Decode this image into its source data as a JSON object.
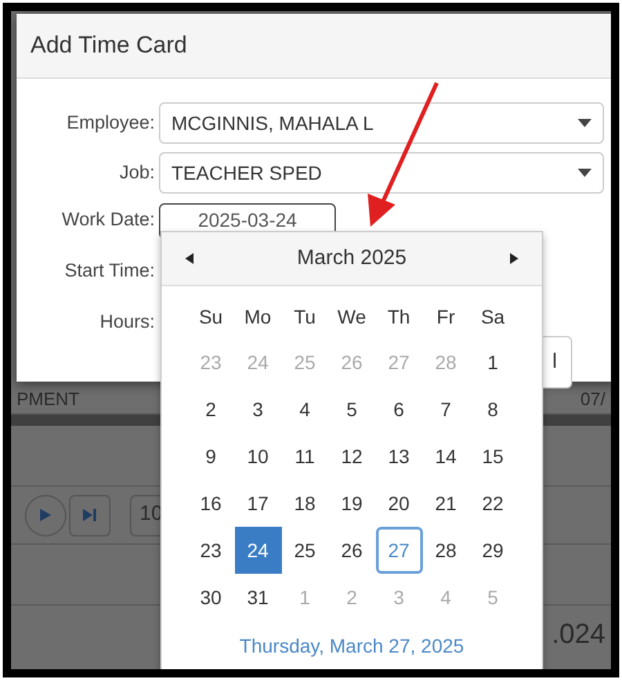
{
  "dialog": {
    "title": "Add Time Card",
    "fields": [
      {
        "label": "Employee:",
        "kind": "select",
        "value": "MCGINNIS, MAHALA L"
      },
      {
        "label": "Job:",
        "kind": "select",
        "value": "TEACHER SPED"
      },
      {
        "label": "Work Date:",
        "kind": "date",
        "value": "2025-03-24"
      },
      {
        "label": "Start Time:",
        "kind": "hidden"
      },
      {
        "label": "Hours:",
        "kind": "hidden"
      }
    ],
    "button_fragment": "l"
  },
  "calendar": {
    "title": "March 2025",
    "weekdays": [
      "Su",
      "Mo",
      "Tu",
      "We",
      "Th",
      "Fr",
      "Sa"
    ],
    "weeks": [
      [
        {
          "label": "23",
          "outside": true,
          "selected": false,
          "today": false
        },
        {
          "label": "24",
          "outside": true,
          "selected": false,
          "today": false
        },
        {
          "label": "25",
          "outside": true,
          "selected": false,
          "today": false
        },
        {
          "label": "26",
          "outside": true,
          "selected": false,
          "today": false
        },
        {
          "label": "27",
          "outside": true,
          "selected": false,
          "today": false
        },
        {
          "label": "28",
          "outside": true,
          "selected": false,
          "today": false
        },
        {
          "label": "1",
          "outside": false,
          "selected": false,
          "today": false
        }
      ],
      [
        {
          "label": "2",
          "outside": false,
          "selected": false,
          "today": false
        },
        {
          "label": "3",
          "outside": false,
          "selected": false,
          "today": false
        },
        {
          "label": "4",
          "outside": false,
          "selected": false,
          "today": false
        },
        {
          "label": "5",
          "outside": false,
          "selected": false,
          "today": false
        },
        {
          "label": "6",
          "outside": false,
          "selected": false,
          "today": false
        },
        {
          "label": "7",
          "outside": false,
          "selected": false,
          "today": false
        },
        {
          "label": "8",
          "outside": false,
          "selected": false,
          "today": false
        }
      ],
      [
        {
          "label": "9",
          "outside": false,
          "selected": false,
          "today": false
        },
        {
          "label": "10",
          "outside": false,
          "selected": false,
          "today": false
        },
        {
          "label": "11",
          "outside": false,
          "selected": false,
          "today": false
        },
        {
          "label": "12",
          "outside": false,
          "selected": false,
          "today": false
        },
        {
          "label": "13",
          "outside": false,
          "selected": false,
          "today": false
        },
        {
          "label": "14",
          "outside": false,
          "selected": false,
          "today": false
        },
        {
          "label": "15",
          "outside": false,
          "selected": false,
          "today": false
        }
      ],
      [
        {
          "label": "16",
          "outside": false,
          "selected": false,
          "today": false
        },
        {
          "label": "17",
          "outside": false,
          "selected": false,
          "today": false
        },
        {
          "label": "18",
          "outside": false,
          "selected": false,
          "today": false
        },
        {
          "label": "19",
          "outside": false,
          "selected": false,
          "today": false
        },
        {
          "label": "20",
          "outside": false,
          "selected": false,
          "today": false
        },
        {
          "label": "21",
          "outside": false,
          "selected": false,
          "today": false
        },
        {
          "label": "22",
          "outside": false,
          "selected": false,
          "today": false
        }
      ],
      [
        {
          "label": "23",
          "outside": false,
          "selected": false,
          "today": false
        },
        {
          "label": "24",
          "outside": false,
          "selected": true,
          "today": false
        },
        {
          "label": "25",
          "outside": false,
          "selected": false,
          "today": false
        },
        {
          "label": "26",
          "outside": false,
          "selected": false,
          "today": false
        },
        {
          "label": "27",
          "outside": false,
          "selected": false,
          "today": true
        },
        {
          "label": "28",
          "outside": false,
          "selected": false,
          "today": false
        },
        {
          "label": "29",
          "outside": false,
          "selected": false,
          "today": false
        }
      ],
      [
        {
          "label": "30",
          "outside": false,
          "selected": false,
          "today": false
        },
        {
          "label": "31",
          "outside": false,
          "selected": false,
          "today": false
        },
        {
          "label": "1",
          "outside": true,
          "selected": false,
          "today": false
        },
        {
          "label": "2",
          "outside": true,
          "selected": false,
          "today": false
        },
        {
          "label": "3",
          "outside": true,
          "selected": false,
          "today": false
        },
        {
          "label": "4",
          "outside": true,
          "selected": false,
          "today": false
        },
        {
          "label": "5",
          "outside": true,
          "selected": false,
          "today": false
        }
      ]
    ],
    "footer": "Thursday, March 27, 2025"
  },
  "background": {
    "row_text": "PMENT",
    "row_date": "07/",
    "page_field": "10",
    "corner_text": ".024"
  }
}
